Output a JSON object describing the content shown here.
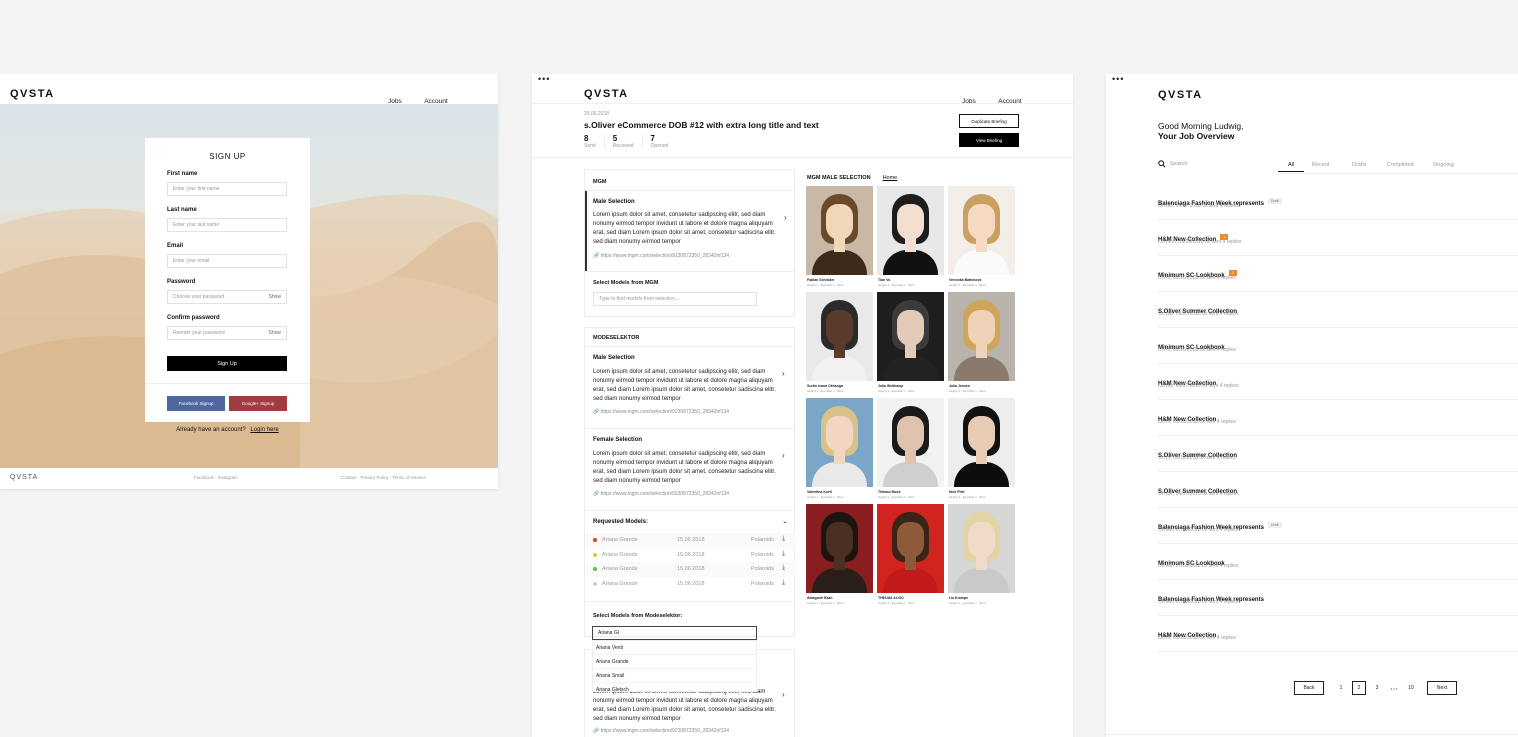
{
  "signup": {
    "logo": "QVSTA",
    "nav": [
      "Jobs",
      "Account"
    ],
    "title": "SIGN UP",
    "fields": [
      {
        "label": "First name",
        "placeholder": "Enter your first name",
        "show": ""
      },
      {
        "label": "Last name",
        "placeholder": "Enter your last name",
        "show": ""
      },
      {
        "label": "Email",
        "placeholder": "Enter your email",
        "show": ""
      },
      {
        "label": "Password",
        "placeholder": "Choose your password",
        "show": "Show"
      },
      {
        "label": "Confirm password",
        "placeholder": "Reenter your password",
        "show": "Show"
      }
    ],
    "submit": "Sign Up",
    "facebook": "Facebook Signup",
    "google": "Google+ Signup",
    "have_account": "Already have an account?",
    "login": "Login here",
    "footer_logo": "QVSTA",
    "footer_social": "Facebook - Instagram",
    "footer_links": "Contact - Privacy Policy - Terms of Service",
    "colors": {
      "facebook": "#4e67a1",
      "google": "#a23c43"
    }
  },
  "briefing": {
    "logo": "QVSTA",
    "nav": [
      "Jobs",
      "Account"
    ],
    "date": "25.06.2018",
    "title": "s.Oliver eCommerce DOB #12 with extra long title and text",
    "stats": [
      {
        "value": "8",
        "label": "Send"
      },
      {
        "value": "5",
        "label": "Received"
      },
      {
        "value": "7",
        "label": "Opened"
      }
    ],
    "duplicate": "Duplicate Briefing",
    "view": "View Briefing",
    "mgm": {
      "heading": "MGM",
      "selection_title": "Male Selection",
      "text": "Lorem ipsum dolor sit amet, consetetur sadipscing elitr, sed diam nonumy eirmod tempor invidunt ut labore et dolore magna aliquyam erat, sed diam Lorem ipsum dolor sit amet, consetetur sadiscina elitr. sed diam nonumy eirmod tempor",
      "url": "https://www.mgm.com/selection/9230872350_28342nf134",
      "select_label": "Select Models from MGM",
      "select_placeholder": "Type to find models from selection..."
    },
    "modeselektor": {
      "heading": "MODESELEKTOR",
      "male_title": "Male Selection",
      "male_text": "Lorem ipsum dolor sit amet, consetetur sadipscing elitr, sed diam nonumy eirmod tempor invidunt ut labore et dolore magna aliquyam erat, sed diam Lorem ipsum dolor sit amet, consetetur sadiscina elitr. sed diam nonumy eirmod tempor",
      "male_url": "https://www.mgm.com/selection/9230872350_28342nf134",
      "female_title": "Female Selection",
      "female_text": "Lorem ipsum dolor sit amet, consetetur sadipscing elitr, sed diam nonumy eirmod tempor invidunt ut labore et dolore magna aliquyam erat, sed diam Lorem ipsum dolor sit amet, consetetur sadiscina elitr. sed diam nonumy eirmod tempor",
      "female_url": "https://www.mgm.com/selection/9230872350_28342nf134",
      "requested_label": "Requested Models:",
      "requested": [
        {
          "name": "Ariana Grande",
          "date": "15.06.2018",
          "action": "Polaroids",
          "color": "#d9452b"
        },
        {
          "name": "Ariana Grande",
          "date": "15.06.2018",
          "action": "Polaroids",
          "color": "#e8c22a"
        },
        {
          "name": "Ariana Grande",
          "date": "15.06.2018",
          "action": "Polaroids",
          "color": "#6cbb3c"
        },
        {
          "name": "Ariana Grande",
          "date": "15.06.2018",
          "action": "Polaroids",
          "color": "#cfcfcf"
        }
      ],
      "select_label": "Select Models from Modeselektor:",
      "select_value": "Ariana Gl",
      "options": [
        "Ariana Venti",
        "Ariana Grande",
        "Ariana Small",
        "Ariana Gletsch"
      ],
      "bottom_text": "Lorem ipsum dolor sit amet, consetetur sadipscing elitr, sed diam nonumy eirmod tempor invidunt ut labore et dolore magna aliquyam erat, sed diam Lorem ipsum dolor sit amet, consetetur sadiscina elitr. sed diam nonumy eirmod tempor",
      "bottom_url": "https://www.mgm.com/selection/9230872350_28342nf134"
    },
    "gallery": {
      "title": "MGM MALE SELECTION",
      "home": "Home",
      "models": [
        {
          "name": "Fabian Schröder",
          "meta": "Height 1 - Eye/Hair 1 - Bust"
        },
        {
          "name": "Tian Vu",
          "meta": "Height 1 - Eye/Hair 1 - Bust"
        },
        {
          "name": "Veronika Batishova",
          "meta": "Height 1 - Eye/Hair 1 - Bust"
        },
        {
          "name": "Surtin Ivana Okhanga",
          "meta": "Height 1 - Eye/Hair 1 - Bust"
        },
        {
          "name": "Julia Weitkamp",
          "meta": "Height 1 - Eye/Hair 1 - Bust"
        },
        {
          "name": "Julia Jensen",
          "meta": "Height 1 - Eye/Hair 1 - Bust"
        },
        {
          "name": "Valentina Knell",
          "meta": "Height 1 - Eye/Hair 1 - Bust"
        },
        {
          "name": "Thibaut Mock",
          "meta": "Height 1 - Eye/Hair 1 - Bust"
        },
        {
          "name": "Nick Fleit",
          "meta": "Height 1 - Eye/Hair 1 - Bust"
        },
        {
          "name": "Abiagnoh Ekah",
          "meta": "Height 1 - Eye/Hair 1 - Bust"
        },
        {
          "name": "THELMA ALVIO",
          "meta": "Height 1 - Eye/Hair 1 - Bust"
        },
        {
          "name": "Lia Krampe",
          "meta": "Height 1 - Eye/Hair 1 - Bust"
        }
      ]
    }
  },
  "overview": {
    "logo": "QVSTA",
    "greeting": "Good Morning Ludwig,",
    "subtitle": "Your Job Overview",
    "search_placeholder": "Search",
    "tabs": [
      "All",
      "Recent",
      "Drafts",
      "Completed",
      "Ongoing"
    ],
    "jobs": [
      {
        "title": "Balenciaga Fashion Week represents",
        "sub": "On tue, 09/07/2018 0x sent 4 replies",
        "badge": "Draft",
        "badge_type": "draft"
      },
      {
        "title": "H&M New Collection",
        "sub": "On mon, 09/09/2018 0x sent 4 replies",
        "badge": "1",
        "badge_type": "count"
      },
      {
        "title": "Minimum SC Lookbook",
        "sub": "On fri, 09/10/2018 0x sent 4 replies",
        "badge": "2",
        "badge_type": "count"
      },
      {
        "title": "S.Oliver Summer Collection",
        "sub": "On tue, 09/07/2018 0x sent 4 replies",
        "badge": "",
        "badge_type": ""
      },
      {
        "title": "Minimum SC Lookbook",
        "sub": "On fri, 09/10/2018 0x sent 4 replies",
        "badge": "",
        "badge_type": ""
      },
      {
        "title": "H&M New Collection",
        "sub": "On tue, 09/07/2018 0x sent 4 replies",
        "badge": "",
        "badge_type": ""
      },
      {
        "title": "H&M New Collection",
        "sub": "On fri, 09/10/2018 0x sent 4 replies",
        "badge": "",
        "badge_type": ""
      },
      {
        "title": "S.Oliver Summer Collection",
        "sub": "On fri, 09/10/2018 0x sent 4 replies",
        "badge": "",
        "badge_type": ""
      },
      {
        "title": "S.Oliver Summer Collection",
        "sub": "On tue, 09/07/2018 0x sent 4 replies",
        "badge": "",
        "badge_type": ""
      },
      {
        "title": "Balenciaga Fashion Week represents",
        "sub": "On sun 07/28/2018 0x sent 4 replies",
        "badge": "Draft",
        "badge_type": "draft"
      },
      {
        "title": "Minimum SC Lookbook",
        "sub": "On sun 07/28/2018 0x sent 4 replies",
        "badge": "",
        "badge_type": ""
      },
      {
        "title": "Balenciaga Fashion Week represents",
        "sub": "On sun 07/28/2018 0x sent 4 replies",
        "badge": "",
        "badge_type": ""
      },
      {
        "title": "H&M New Collection",
        "sub": "On fri, 09/10/2018 0x sent 4 replies",
        "badge": "",
        "badge_type": ""
      }
    ],
    "pagination": {
      "back": "Back",
      "pages": [
        "1",
        "2",
        "3"
      ],
      "ellipsis": "• • •",
      "last": "10",
      "next": "Next",
      "current": "2"
    },
    "colors": {
      "accent_badge": "#f0892b"
    }
  }
}
